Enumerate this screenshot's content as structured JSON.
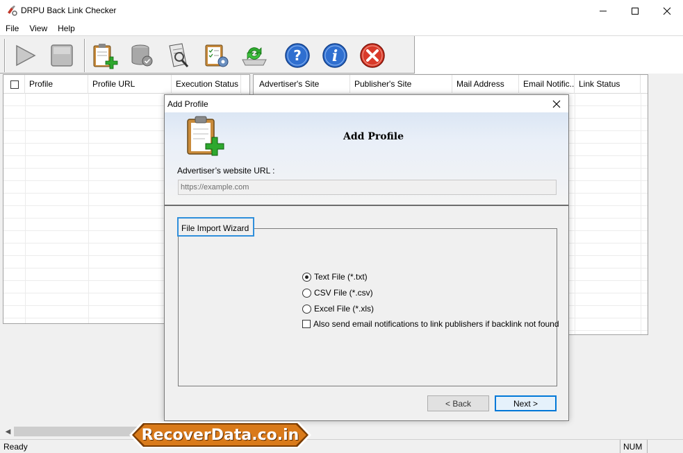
{
  "window": {
    "title": "DRPU Back Link Checker"
  },
  "menu": {
    "items": [
      "File",
      "View",
      "Help"
    ]
  },
  "toolbar": {
    "buttons": [
      {
        "name": "start",
        "icon": "play-icon"
      },
      {
        "name": "stop",
        "icon": "stop-icon"
      },
      {
        "name": "add-profile",
        "icon": "clipboard-add-icon"
      },
      {
        "name": "database",
        "icon": "database-check-icon"
      },
      {
        "name": "report",
        "icon": "report-search-icon"
      },
      {
        "name": "settings",
        "icon": "settings-checklist-icon"
      },
      {
        "name": "refresh",
        "icon": "refresh-drive-icon"
      },
      {
        "name": "help",
        "icon": "help-icon"
      },
      {
        "name": "about",
        "icon": "info-icon"
      },
      {
        "name": "exit",
        "icon": "close-circle-icon"
      }
    ]
  },
  "left_grid": {
    "columns": [
      "Profile",
      "Profile URL",
      "Execution Status"
    ]
  },
  "right_grid": {
    "columns": [
      "Advertiser's Site",
      "Publisher's Site",
      "Mail Address",
      "Email Notific...",
      "Link Status"
    ]
  },
  "statusbar": {
    "text": "Ready",
    "num": "NUM"
  },
  "dialog": {
    "title": "Add Profile",
    "heading": "Add Profile",
    "url_label": "Advertiser’s website URL :",
    "url_placeholder": "https://example.com",
    "group_title": "File Import Wizard",
    "options": [
      {
        "label": "Text File (*.txt)",
        "selected": true
      },
      {
        "label": "CSV File (*.csv)",
        "selected": false
      },
      {
        "label": "Excel File (*.xls)",
        "selected": false
      }
    ],
    "email_checkbox_label": "Also send email notifications to link publishers if backlink not found",
    "email_checkbox_checked": false,
    "back_label": "< Back",
    "next_label": "Next >"
  },
  "watermark": {
    "text": "RecoverData.co.in"
  },
  "colors": {
    "accent": "#0078d7",
    "banner": "#d97a1a",
    "banner_border": "#ffffff"
  }
}
